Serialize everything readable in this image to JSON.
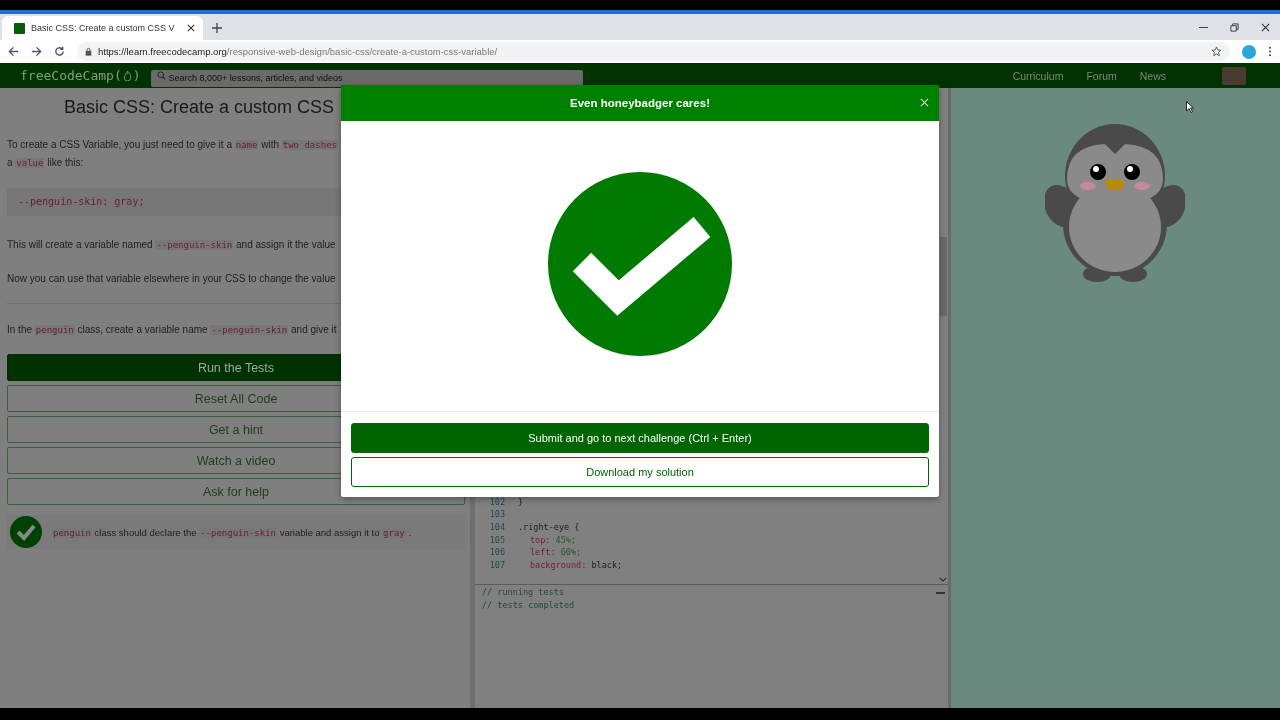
{
  "browser": {
    "tab_title": "Basic CSS: Create a custom CSS V",
    "url_host": "https://learn.freecodecamp.org",
    "url_path": "/responsive-web-design/basic-css/create-a-custom-css-variable/"
  },
  "nav": {
    "logo_start": "freeCodeCamp(",
    "logo_end": ")",
    "search_placeholder": "Search 8,000+ lessons, articles, and videos",
    "links": [
      "Curriculum",
      "Forum",
      "News"
    ]
  },
  "challenge": {
    "title": "Basic CSS: Create a custom CSS",
    "paragraphs": [
      {
        "kind": "text",
        "lines": [
          [
            {
              "t": "To create a CSS Variable, you just need to give it a",
              "kind": "text"
            },
            {
              "t": "name",
              "kind": "code"
            },
            {
              "t": "with",
              "kind": "text"
            },
            {
              "t": "two dashes",
              "kind": "code"
            }
          ],
          [
            {
              "t": "a",
              "kind": "text"
            },
            {
              "t": "value",
              "kind": "code"
            },
            {
              "t": "like this:",
              "kind": "text"
            }
          ]
        ]
      },
      {
        "kind": "snippet",
        "lines": [
          [
            {
              "t": "--penguin-skin: gray;",
              "kind": "code"
            }
          ]
        ]
      },
      {
        "kind": "text",
        "lines": [
          [
            {
              "t": "This will create a variable named",
              "kind": "text"
            },
            {
              "t": "--penguin-skin",
              "kind": "code"
            },
            {
              "t": "and assign it the value",
              "kind": "text"
            }
          ]
        ]
      },
      {
        "kind": "text",
        "lines": [
          [
            {
              "t": "Now you can use that variable elsewhere in your CSS to change the value",
              "kind": "text"
            }
          ]
        ]
      },
      {
        "kind": "rule"
      },
      {
        "kind": "text",
        "lines": [
          [
            {
              "t": "In the",
              "kind": "text"
            },
            {
              "t": "penguin",
              "kind": "code"
            },
            {
              "t": "class, create a variable name",
              "kind": "text"
            },
            {
              "t": "--penguin-skin",
              "kind": "code"
            },
            {
              "t": "and give it",
              "kind": "text"
            }
          ]
        ]
      }
    ],
    "buttons": [
      {
        "label": "Run the Tests",
        "kind": "primary"
      },
      {
        "label": "Reset All Code",
        "kind": "outline"
      },
      {
        "label": "Get a hint",
        "kind": "outline"
      },
      {
        "label": "Watch a video",
        "kind": "outline"
      },
      {
        "label": "Ask for help",
        "kind": "outline"
      }
    ],
    "tests": [
      {
        "passed": true,
        "parts": [
          {
            "t": "penguin",
            "kind": "code"
          },
          {
            "t": "class should declare the",
            "kind": "text"
          },
          {
            "t": "--penguin-skin",
            "kind": "code"
          },
          {
            "t": "variable and assign it to",
            "kind": "text"
          },
          {
            "t": "gray",
            "kind": "code"
          },
          {
            "t": ".",
            "kind": "text"
          }
        ]
      }
    ]
  },
  "editor": {
    "lines": [
      {
        "number": "102",
        "kind": "rule",
        "tokens": [
          {
            "t": "}",
            "kind": "plain"
          }
        ]
      },
      {
        "number": "103",
        "kind": "blank"
      },
      {
        "number": "104",
        "kind": "rule",
        "tokens": [
          {
            "t": ".right-eye {",
            "kind": "plain"
          }
        ]
      },
      {
        "number": "105",
        "kind": "declaration",
        "tokens": [
          {
            "t": "top:",
            "kind": "property"
          },
          {
            "t": "45%;",
            "kind": "number"
          }
        ]
      },
      {
        "number": "106",
        "kind": "declaration",
        "tokens": [
          {
            "t": "left:",
            "kind": "property"
          },
          {
            "t": "60%;",
            "kind": "number"
          }
        ]
      },
      {
        "number": "107",
        "kind": "declaration",
        "tokens": [
          {
            "t": "background:",
            "kind": "property"
          },
          {
            "t": "black;",
            "kind": "plain"
          }
        ]
      }
    ]
  },
  "console": [
    "// running tests",
    "// tests completed"
  ],
  "modal": {
    "title": "Even honeybadger cares!",
    "buttons": [
      {
        "label": "Submit and go to next challenge (Ctrl + Enter)",
        "kind": "primary"
      },
      {
        "label": "Download my solution",
        "kind": "outline"
      }
    ]
  }
}
